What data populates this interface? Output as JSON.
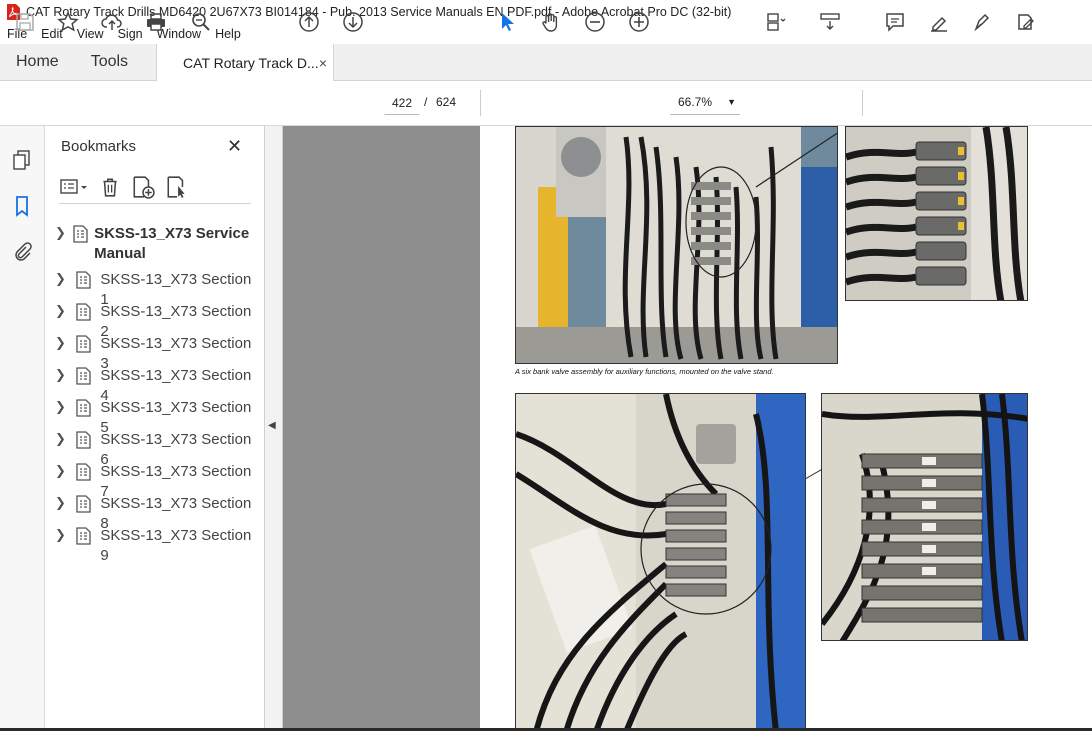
{
  "window": {
    "title": "CAT Rotary Track Drills MD6420 2U67X73 BI014184 - Pub. 2013 Service Manuals EN PDF.pdf - Adobe Acrobat Pro DC (32-bit)"
  },
  "menu": [
    "File",
    "Edit",
    "View",
    "Sign",
    "Window",
    "Help"
  ],
  "tabs": {
    "home": "Home",
    "tools": "Tools",
    "document": "CAT Rotary Track D...",
    "close": "×"
  },
  "toolbar": {
    "current_page": "422",
    "page_separator": "/",
    "total_pages": "624",
    "zoom": "66.7%"
  },
  "bookmarks": {
    "title": "Bookmarks",
    "close": "✕",
    "items": [
      "SKSS-13_X73 Service Manual",
      "SKSS-13_X73 Section 1",
      "SKSS-13_X73 Section 2",
      "SKSS-13_X73 Section 3",
      "SKSS-13_X73 Section 4",
      "SKSS-13_X73 Section 5",
      "SKSS-13_X73 Section 6",
      "SKSS-13_X73 Section 7",
      "SKSS-13_X73 Section 8",
      "SKSS-13_X73 Section 9"
    ]
  },
  "document": {
    "caption": "A six bank valve assembly for auxiliary functions, mounted on the valve stand."
  },
  "colors": {
    "accent": "#1473e6",
    "panel_bg": "#f7f7f7",
    "viewer_bg": "#8e8e8e"
  }
}
